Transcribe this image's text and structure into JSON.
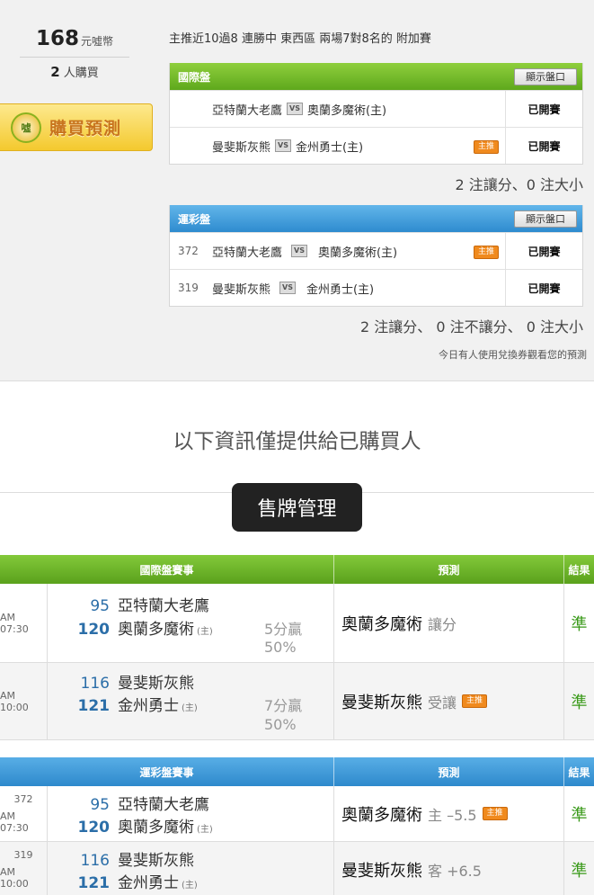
{
  "purchase": {
    "price": "168",
    "currency": "元噓幣",
    "buyers_count": "2",
    "buyers_label": "人購買",
    "buy_button": "購買預測",
    "buy_icon": "噓"
  },
  "description": "主推近10過8 連勝中 東西區 兩場7對8名的 附加賽",
  "intl_panel": {
    "title": "國際盤",
    "show_button": "顯示盤口",
    "rows": [
      {
        "away": "亞特蘭大老鷹",
        "home": "奧蘭多魔術(主)",
        "tag": "",
        "status": "已開賽"
      },
      {
        "away": "曼斐斯灰熊",
        "home": "金州勇士(主)",
        "tag": "主推",
        "status": "已開賽"
      }
    ],
    "summary": "2 注讓分、0 注大小"
  },
  "lottery_panel": {
    "title": "運彩盤",
    "show_button": "顯示盤口",
    "rows": [
      {
        "code": "372",
        "away": "亞特蘭大老鷹",
        "home": "奧蘭多魔術(主)",
        "tag": "主推",
        "status": "已開賽"
      },
      {
        "code": "319",
        "away": "曼斐斯灰熊",
        "home": "金州勇士(主)",
        "tag": "",
        "status": "已開賽"
      }
    ],
    "summary": "2 注讓分、 0 注不讓分、 0 注大小"
  },
  "today_note": "今日有人使用兌換券觀看您的預測",
  "info_text": "以下資訊僅提供給已購買人",
  "manage_button": "售牌管理",
  "intl_table": {
    "headers": [
      "國際盤賽事",
      "預測",
      "結果"
    ],
    "rows": [
      {
        "time": "AM 07:30",
        "code": "",
        "away_score": "95",
        "away": "亞特蘭大老鷹",
        "home_score": "120",
        "home": "奧蘭多魔術",
        "home_mark": "(主)",
        "spread": "5分贏",
        "pct": "50%",
        "pick": "奧蘭多魔術",
        "pick_sub": "讓分",
        "pick_tag": "",
        "result": "準"
      },
      {
        "time": "AM 10:00",
        "code": "",
        "away_score": "116",
        "away": "曼斐斯灰熊",
        "home_score": "121",
        "home": "金州勇士",
        "home_mark": "(主)",
        "spread": "7分贏",
        "pct": "50%",
        "pick": "曼斐斯灰熊",
        "pick_sub": "受讓",
        "pick_tag": "主推",
        "result": "準"
      }
    ]
  },
  "lottery_table": {
    "headers": [
      "運彩盤賽事",
      "預測",
      "結果"
    ],
    "rows": [
      {
        "time": "AM 07:30",
        "code": "372",
        "away_score": "95",
        "away": "亞特蘭大老鷹",
        "home_score": "120",
        "home": "奧蘭多魔術",
        "home_mark": "(主)",
        "pick": "奧蘭多魔術",
        "pick_sub": "主 –5.5",
        "pick_tag": "主推",
        "result": "準"
      },
      {
        "time": "AM 10:00",
        "code": "319",
        "away_score": "116",
        "away": "曼斐斯灰熊",
        "home_score": "121",
        "home": "金州勇士",
        "home_mark": "(主)",
        "pick": "曼斐斯灰熊",
        "pick_sub": "客 +6.5",
        "pick_tag": "",
        "result": "準"
      }
    ]
  },
  "colors": {
    "green_header": "#5ea81c",
    "blue_header": "#2e8bcf",
    "push_tag": "#f08a1e",
    "result_green": "#3a9a1a"
  }
}
